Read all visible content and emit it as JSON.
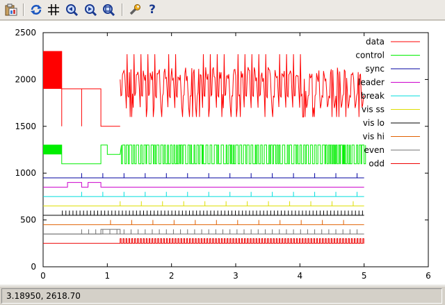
{
  "toolbar": {
    "buttons": [
      {
        "name": "copy-clipboard-button",
        "icon": "clipboard-icon"
      },
      {
        "name": "replot-button",
        "icon": "replot-icon"
      },
      {
        "name": "grid-button",
        "icon": "grid-icon"
      },
      {
        "name": "zoom-prev-button",
        "icon": "zoom-previous-icon"
      },
      {
        "name": "zoom-next-button",
        "icon": "zoom-next-icon"
      },
      {
        "name": "unzoom-button",
        "icon": "unzoom-icon"
      },
      {
        "name": "config-button",
        "icon": "wrench-icon"
      },
      {
        "name": "help-button",
        "icon": "help-icon",
        "label": "?"
      }
    ]
  },
  "status": {
    "coords": "3.18950,  2618.70"
  },
  "chart_data": {
    "type": "line",
    "title": "",
    "xlabel": "",
    "ylabel": "",
    "xlim": [
      0,
      6
    ],
    "ylim": [
      0,
      2500
    ],
    "x_ticks": [
      0,
      1,
      2,
      3,
      4,
      5,
      6
    ],
    "y_ticks": [
      0,
      500,
      1000,
      1500,
      2000,
      2500
    ],
    "x_tick_labels": [
      "0",
      "1",
      "2",
      "3",
      "4",
      "5",
      "6"
    ],
    "y_tick_labels": [
      "0",
      "500",
      "1000",
      "1500",
      "2000",
      "2500"
    ],
    "legend_position": "top-right",
    "series": [
      {
        "name": "data",
        "color": "#ff0000",
        "baseline": 1500,
        "amplitude": 800,
        "points": [
          [
            0,
            2300
          ],
          [
            0.29,
            2300
          ],
          [
            0.29,
            1900
          ],
          [
            0.9,
            1900
          ],
          [
            0.9,
            1500
          ],
          [
            1.2,
            1500
          ],
          [
            1.2,
            2070
          ],
          [
            5.0,
            2000
          ]
        ]
      },
      {
        "name": "control",
        "color": "#00ee00",
        "low": 1100,
        "high": 1300
      },
      {
        "name": "sync",
        "color": "#0000a0",
        "level": 950,
        "pulse_height": 50
      },
      {
        "name": "leader",
        "color": "#cc00cc",
        "level": 850,
        "high": 900
      },
      {
        "name": "break",
        "color": "#00dddd",
        "level": 750,
        "pulse_height": 50
      },
      {
        "name": "vis ss",
        "color": "#dddd00",
        "level": 650,
        "pulse_height": 50
      },
      {
        "name": "vis lo",
        "color": "#000000",
        "level": 550,
        "pulse_height": 50
      },
      {
        "name": "vis hi",
        "color": "#e06000",
        "level": 450,
        "pulse_height": 50
      },
      {
        "name": "even",
        "color": "#707070",
        "level": 350,
        "pulse_height": 50
      },
      {
        "name": "odd",
        "color": "#ee0000",
        "level": 250,
        "pulse_height": 50
      }
    ]
  }
}
